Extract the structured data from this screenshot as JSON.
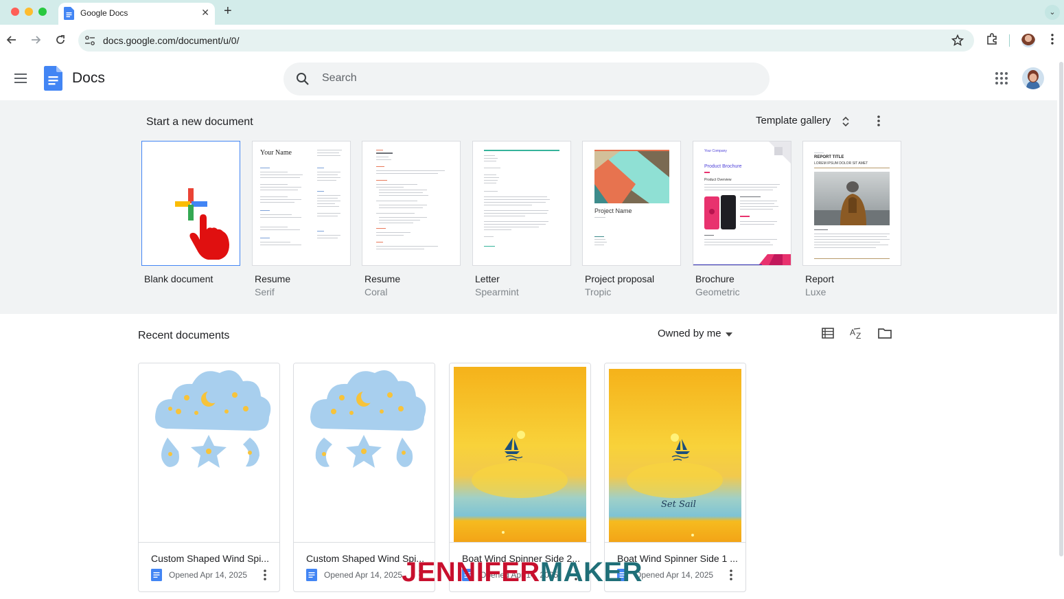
{
  "browser": {
    "tab_title": "Google Docs",
    "url": "docs.google.com/document/u/0/"
  },
  "app": {
    "name": "Docs",
    "search_placeholder": "Search"
  },
  "templates": {
    "heading": "Start a new document",
    "gallery_label": "Template gallery",
    "items": [
      {
        "name": "Blank document",
        "sub": ""
      },
      {
        "name": "Resume",
        "sub": "Serif",
        "thumb_text": "Your Name"
      },
      {
        "name": "Resume",
        "sub": "Coral"
      },
      {
        "name": "Letter",
        "sub": "Spearmint"
      },
      {
        "name": "Project proposal",
        "sub": "Tropic",
        "thumb_text": "Project Name"
      },
      {
        "name": "Brochure",
        "sub": "Geometric",
        "thumb_text": "Product Brochure",
        "thumb_text2": "Your Company",
        "thumb_text3": "Product Overview"
      },
      {
        "name": "Report",
        "sub": "Luxe",
        "thumb_text": "REPORT TITLE",
        "thumb_text2": "LOREM IPSUM DOLOR SIT AMET"
      }
    ]
  },
  "recent": {
    "heading": "Recent documents",
    "filter_label": "Owned by me",
    "docs": [
      {
        "title": "Custom Shaped Wind Spi...",
        "meta": "Opened Apr 14, 2025"
      },
      {
        "title": "Custom Shaped Wind Spi...",
        "meta": "Opened Apr 14, 2025"
      },
      {
        "title": "Boat Wind Spinner Side 2...",
        "meta": "Opened Apr 14, 2025"
      },
      {
        "title": "Boat Wind Spinner Side 1 ...",
        "meta": "Opened Apr 14, 2025",
        "preview_text": "Set Sail"
      }
    ]
  },
  "watermark": {
    "part1": "JENNIFER",
    "part2": "MAKER"
  },
  "colors": {
    "docs_blue": "#4285f4",
    "tab_bar": "#d3ecea",
    "watermark_red": "#c8102e",
    "watermark_teal": "#1f6f78"
  }
}
